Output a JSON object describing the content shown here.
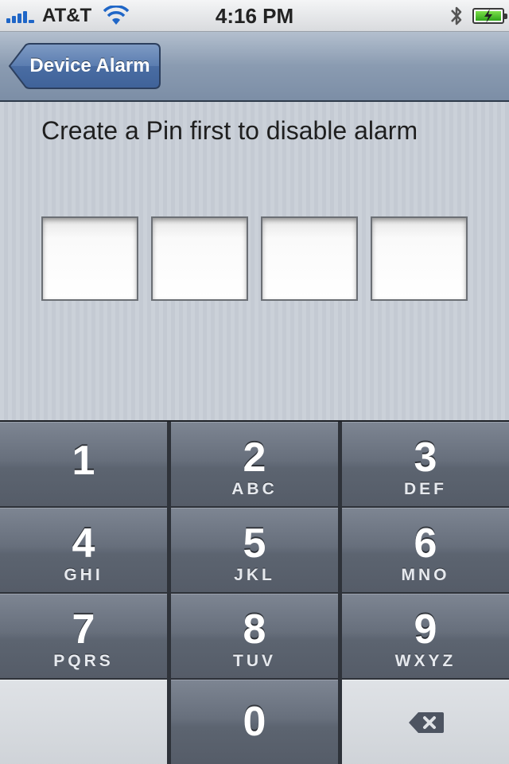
{
  "status_bar": {
    "carrier": "AT&T",
    "time": "4:16 PM",
    "icons": [
      "signal-icon",
      "wifi-icon",
      "bluetooth-icon",
      "battery-icon"
    ]
  },
  "nav_bar": {
    "back_label": "Device Alarm"
  },
  "main": {
    "prompt": "Create a Pin first to disable alarm",
    "pin_slots": [
      "",
      "",
      "",
      ""
    ]
  },
  "keypad": {
    "keys": [
      {
        "digit": "1",
        "letters": ""
      },
      {
        "digit": "2",
        "letters": "ABC"
      },
      {
        "digit": "3",
        "letters": "DEF"
      },
      {
        "digit": "4",
        "letters": "GHI"
      },
      {
        "digit": "5",
        "letters": "JKL"
      },
      {
        "digit": "6",
        "letters": "MNO"
      },
      {
        "digit": "7",
        "letters": "PQRS"
      },
      {
        "digit": "8",
        "letters": "TUV"
      },
      {
        "digit": "9",
        "letters": "WXYZ"
      },
      {
        "digit": "0",
        "letters": ""
      }
    ],
    "delete_icon": "backspace-icon"
  },
  "colors": {
    "nav_accent": "#4f73a5",
    "signal": "#1f66c7",
    "battery": "#2fa51a"
  }
}
